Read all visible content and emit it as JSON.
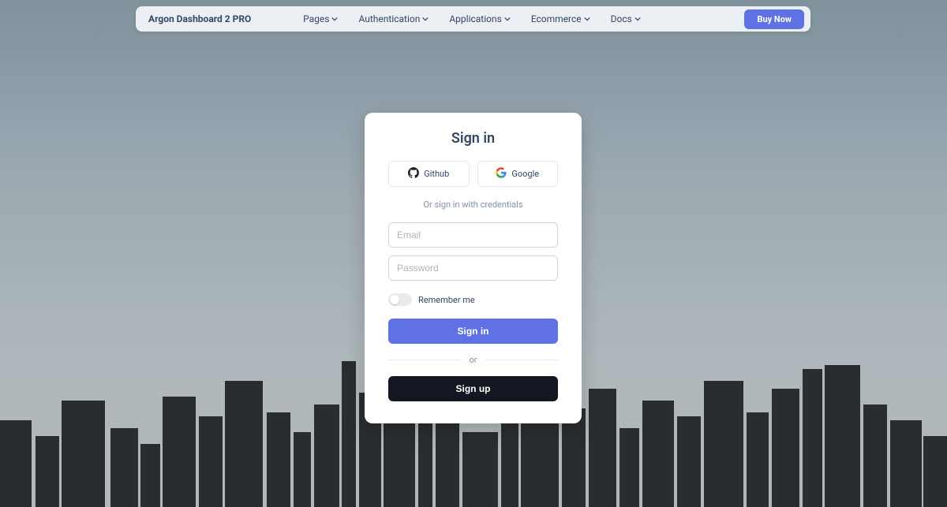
{
  "navbar": {
    "brand": "Argon Dashboard 2 PRO",
    "items": [
      "Pages",
      "Authentication",
      "Applications",
      "Ecommerce",
      "Docs"
    ],
    "buy": "Buy Now"
  },
  "card": {
    "title": "Sign in",
    "oauth": {
      "github": "Github",
      "google": "Google"
    },
    "credentials_text": "Or sign in with credentials",
    "email_placeholder": "Email",
    "password_placeholder": "Password",
    "remember": "Remember me",
    "signin": "Sign in",
    "divider": "or",
    "signup": "Sign up"
  },
  "colors": {
    "primary": "#5e72e4",
    "dark": "#141722",
    "text": "#344767",
    "muted": "#8392ab"
  }
}
